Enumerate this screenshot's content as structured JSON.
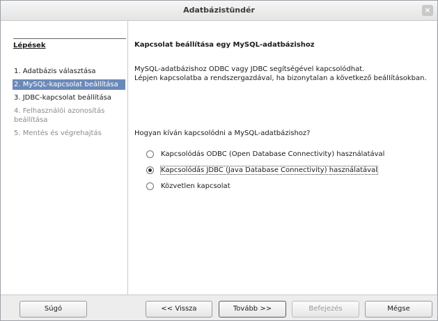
{
  "window": {
    "title": "Adatbázistündér",
    "close_glyph": "×"
  },
  "sidebar": {
    "title": "Lépések",
    "steps": [
      {
        "label": "1. Adatbázis választása",
        "state": "normal"
      },
      {
        "label": "2. MySQL-kapcsolat beállítása",
        "state": "active"
      },
      {
        "label": "3. JDBC-kapcsolat beállítása",
        "state": "normal"
      },
      {
        "label": "4. Felhasználói azonosítás beállítása",
        "state": "disabled"
      },
      {
        "label": "5. Mentés és végrehajtás",
        "state": "disabled"
      }
    ]
  },
  "main": {
    "heading": "Kapcsolat beállítása egy MySQL-adatbázishoz",
    "description_line1": "MySQL-adatbázishoz ODBC vagy JDBC segítségével kapcsolódhat.",
    "description_line2": "Lépjen kapcsolatba a rendszergazdával, ha bizonytalan a következő beállításokban.",
    "question": "Hogyan kíván kapcsolódni a MySQL-adatbázishoz?",
    "options": [
      {
        "label": "Kapcsolódás ODBC (Open Database Connectivity) használatával",
        "checked": false
      },
      {
        "label": "Kapcsolódás JDBC (Java Database Connectivity) használatával",
        "checked": true
      },
      {
        "label": "Közvetlen kapcsolat",
        "checked": false
      }
    ]
  },
  "buttons": {
    "help": "Súgó",
    "back": "<< Vissza",
    "next": "Tovább >>",
    "finish": "Befejezés",
    "cancel": "Mégse"
  }
}
